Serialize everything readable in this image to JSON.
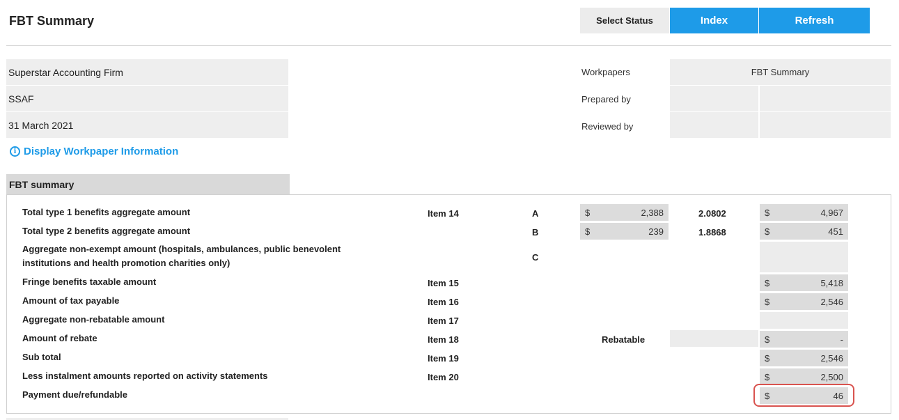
{
  "header": {
    "title": "FBT Summary",
    "select_status_label": "Select Status",
    "index_label": "Index",
    "refresh_label": "Refresh"
  },
  "client": {
    "firm": "Superstar Accounting Firm",
    "entity": "SSAF",
    "period": "31 March 2021"
  },
  "meta": {
    "workpapers_label": "Workpapers",
    "workpapers_value": "FBT Summary",
    "prepared_by_label": "Prepared by",
    "reviewed_by_label": "Reviewed by"
  },
  "display_link": "Display Workpaper Information",
  "section": {
    "title": "FBT summary",
    "rows": [
      {
        "label": "Total type 1 benefits aggregate amount",
        "item": "Item 14",
        "letter": "A",
        "cur1": "$",
        "amount1": "2,388",
        "multiplier": "2.0802",
        "cur2": "$",
        "amount2": "4,967"
      },
      {
        "label": "Total type 2 benefits aggregate amount",
        "item": "",
        "letter": "B",
        "cur1": "$",
        "amount1": "239",
        "multiplier": "1.8868",
        "cur2": "$",
        "amount2": "451"
      },
      {
        "label_line1": "Aggregate non-exempt amount (hospitals, ambulances, public benevolent",
        "label_line2": "institutions and health promotion charities only)",
        "letter": "C"
      },
      {
        "label": "Fringe benefits taxable amount",
        "item": "Item 15",
        "cur2": "$",
        "amount2": "5,418"
      },
      {
        "label": "Amount of tax payable",
        "item": "Item 16",
        "cur2": "$",
        "amount2": "2,546"
      },
      {
        "label": "Aggregate non-rebatable amount",
        "item": "Item 17"
      },
      {
        "label": "Amount of rebate",
        "item": "Item 18",
        "rebatable": "Rebatable",
        "cur2": "$",
        "amount2": "-"
      },
      {
        "label": "Sub total",
        "item": "Item 19",
        "cur2": "$",
        "amount2": "2,546"
      },
      {
        "label": "Less instalment amounts reported on activity statements",
        "item": "Item 20",
        "cur2": "$",
        "amount2": "2,500"
      },
      {
        "label": "Payment due/refundable",
        "item": "",
        "cur2": "$",
        "amount2": "46"
      }
    ]
  },
  "colors": {
    "accent": "#1e9be8",
    "highlight": "#d9534f"
  },
  "icons": {
    "info": "info-circle-icon"
  }
}
